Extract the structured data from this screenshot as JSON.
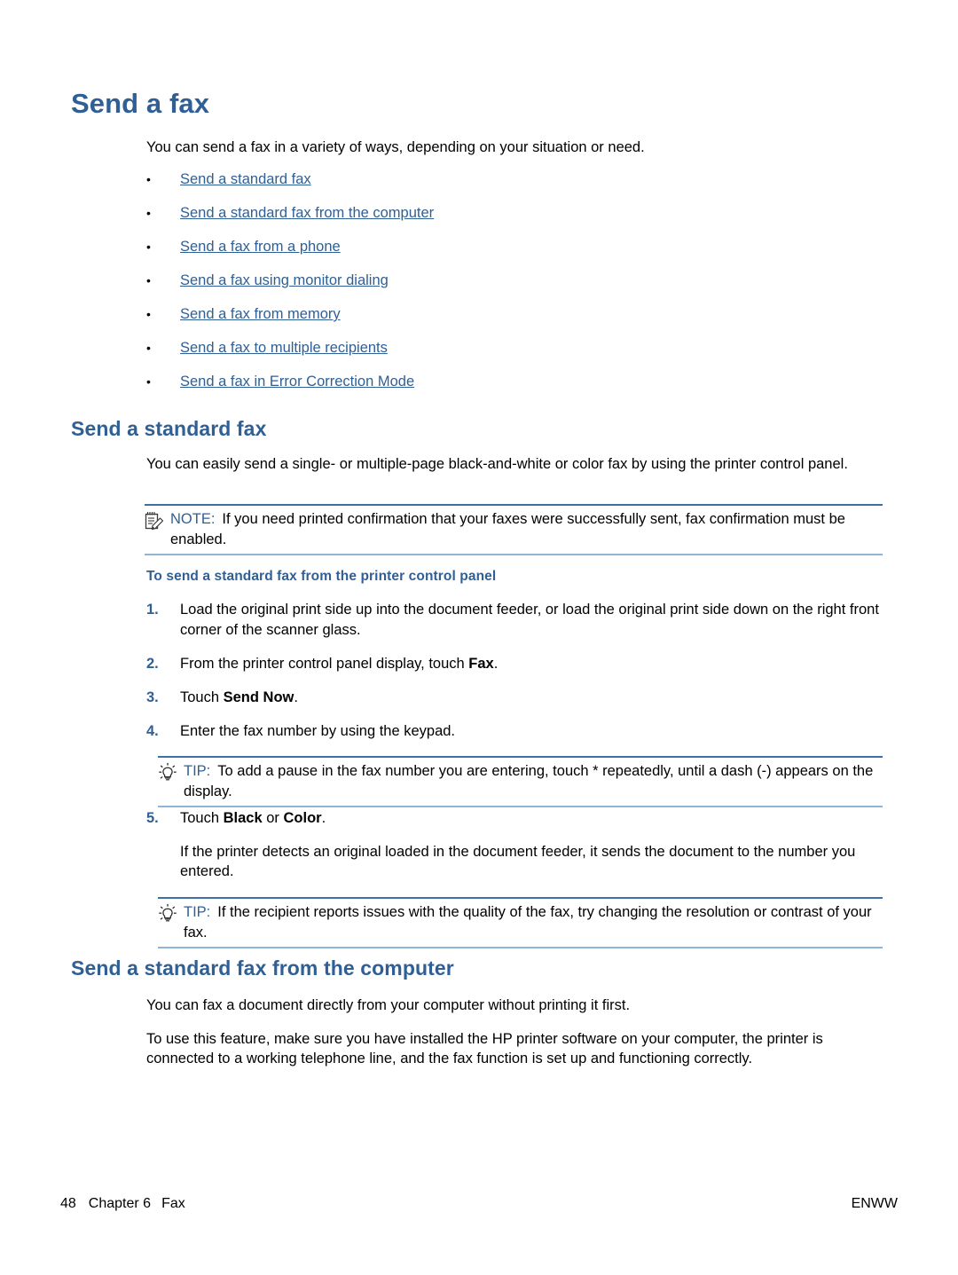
{
  "page": {
    "title": "Send a fax",
    "intro": "You can send a fax in a variety of ways, depending on your situation or need."
  },
  "link_list": [
    {
      "label": "Send a standard fax"
    },
    {
      "label": "Send a standard fax from the computer"
    },
    {
      "label": "Send a fax from a phone"
    },
    {
      "label": "Send a fax using monitor dialing"
    },
    {
      "label": "Send a fax from memory"
    },
    {
      "label": "Send a fax to multiple recipients"
    },
    {
      "label": "Send a fax in Error Correction Mode"
    }
  ],
  "section_standard_fax": {
    "heading": "Send a standard fax",
    "paragraph": "You can easily send a single- or multiple-page black-and-white or color fax by using the printer control panel.",
    "note": {
      "label": "NOTE:",
      "icon": "note-pencil-icon",
      "text": "If you need printed confirmation that your faxes were successfully sent, fax confirmation must be enabled."
    },
    "procedure_heading": "To send a standard fax from the printer control panel",
    "steps": [
      {
        "num": "1.",
        "text": "Load the original print side up into the document feeder, or load the original print side down on the right front corner of the scanner glass."
      },
      {
        "num": "2.",
        "text_before": "From the printer control panel display, touch ",
        "bold": "Fax",
        "text_after": "."
      },
      {
        "num": "3.",
        "text_before": "Touch ",
        "bold": "Send Now",
        "text_after": "."
      },
      {
        "num": "4.",
        "text": "Enter the fax number by using the keypad."
      },
      {
        "num": "5.",
        "text_before": "Touch ",
        "bold": "Black",
        "text_mid": " or ",
        "bold2": "Color",
        "text_after": "."
      }
    ],
    "tip1": {
      "label": "TIP:",
      "icon": "lightbulb-icon",
      "text": "To add a pause in the fax number you are entering, touch * repeatedly, until a dash (-) appears on the display."
    },
    "step5_note": "If the printer detects an original loaded in the document feeder, it sends the document to the number you entered.",
    "tip2": {
      "label": "TIP:",
      "icon": "lightbulb-icon",
      "text": "If the recipient reports issues with the quality of the fax, try changing the resolution or contrast of your fax."
    }
  },
  "section_fax_from_computer": {
    "heading": "Send a standard fax from the computer",
    "paragraph1": "You can fax a document directly from your computer without printing it first.",
    "paragraph2": "To use this feature, make sure you have installed the HP printer software on your computer, the printer is connected to a working telephone line, and the fax function is set up and functioning correctly."
  },
  "footer": {
    "page_number": "48",
    "chapter": "Chapter 6",
    "chapter_title": "Fax",
    "edition": "ENWW"
  },
  "colors": {
    "heading_blue": "#2F5F95",
    "link_blue": "#2F5F95",
    "rule_top": "#3F6FA5",
    "rule_bottom": "#8FB4D6",
    "text_black": "#000000"
  }
}
